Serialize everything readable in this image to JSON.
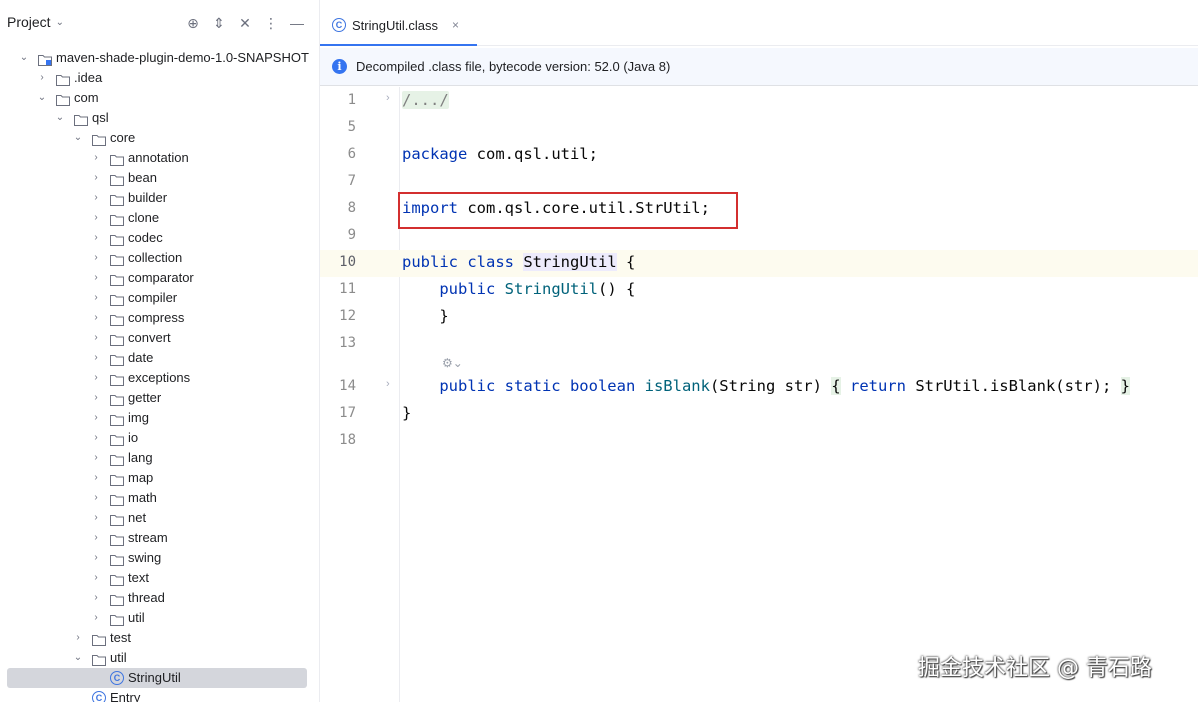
{
  "project_panel": {
    "title": "Project",
    "chevron": "⌄",
    "actions": [
      {
        "name": "locate-icon",
        "glyph": "⊕"
      },
      {
        "name": "expand-all-icon",
        "glyph": "⇕"
      },
      {
        "name": "collapse-all-icon",
        "glyph": "✕"
      },
      {
        "name": "options-icon",
        "glyph": "⋮"
      },
      {
        "name": "hide-icon",
        "glyph": "—"
      }
    ],
    "tree": [
      {
        "label": "maven-shade-plugin-demo-1.0-SNAPSHOT",
        "depth": 0,
        "expanded": true,
        "icon": "module"
      },
      {
        "label": ".idea",
        "depth": 1,
        "expanded": false,
        "icon": "folder"
      },
      {
        "label": "com",
        "depth": 1,
        "expanded": true,
        "icon": "folder"
      },
      {
        "label": "qsl",
        "depth": 2,
        "expanded": true,
        "icon": "folder"
      },
      {
        "label": "core",
        "depth": 3,
        "expanded": true,
        "icon": "folder"
      },
      {
        "label": "annotation",
        "depth": 4,
        "expanded": false,
        "icon": "folder"
      },
      {
        "label": "bean",
        "depth": 4,
        "expanded": false,
        "icon": "folder"
      },
      {
        "label": "builder",
        "depth": 4,
        "expanded": false,
        "icon": "folder"
      },
      {
        "label": "clone",
        "depth": 4,
        "expanded": false,
        "icon": "folder"
      },
      {
        "label": "codec",
        "depth": 4,
        "expanded": false,
        "icon": "folder"
      },
      {
        "label": "collection",
        "depth": 4,
        "expanded": false,
        "icon": "folder"
      },
      {
        "label": "comparator",
        "depth": 4,
        "expanded": false,
        "icon": "folder"
      },
      {
        "label": "compiler",
        "depth": 4,
        "expanded": false,
        "icon": "folder"
      },
      {
        "label": "compress",
        "depth": 4,
        "expanded": false,
        "icon": "folder"
      },
      {
        "label": "convert",
        "depth": 4,
        "expanded": false,
        "icon": "folder"
      },
      {
        "label": "date",
        "depth": 4,
        "expanded": false,
        "icon": "folder"
      },
      {
        "label": "exceptions",
        "depth": 4,
        "expanded": false,
        "icon": "folder"
      },
      {
        "label": "getter",
        "depth": 4,
        "expanded": false,
        "icon": "folder"
      },
      {
        "label": "img",
        "depth": 4,
        "expanded": false,
        "icon": "folder"
      },
      {
        "label": "io",
        "depth": 4,
        "expanded": false,
        "icon": "folder"
      },
      {
        "label": "lang",
        "depth": 4,
        "expanded": false,
        "icon": "folder"
      },
      {
        "label": "map",
        "depth": 4,
        "expanded": false,
        "icon": "folder"
      },
      {
        "label": "math",
        "depth": 4,
        "expanded": false,
        "icon": "folder"
      },
      {
        "label": "net",
        "depth": 4,
        "expanded": false,
        "icon": "folder"
      },
      {
        "label": "stream",
        "depth": 4,
        "expanded": false,
        "icon": "folder"
      },
      {
        "label": "swing",
        "depth": 4,
        "expanded": false,
        "icon": "folder"
      },
      {
        "label": "text",
        "depth": 4,
        "expanded": false,
        "icon": "folder"
      },
      {
        "label": "thread",
        "depth": 4,
        "expanded": false,
        "icon": "folder"
      },
      {
        "label": "util",
        "depth": 4,
        "expanded": false,
        "icon": "folder"
      },
      {
        "label": "test",
        "depth": 3,
        "expanded": false,
        "icon": "folder"
      },
      {
        "label": "util",
        "depth": 3,
        "expanded": true,
        "icon": "folder"
      },
      {
        "label": "StringUtil",
        "depth": 4,
        "leaf": true,
        "icon": "class",
        "selected": true
      },
      {
        "label": "Entry",
        "depth": 3,
        "leaf": true,
        "icon": "class"
      }
    ]
  },
  "editor": {
    "tab": {
      "icon_letter": "C",
      "label": "StringUtil.class",
      "close": "×"
    },
    "banner": {
      "icon": "i",
      "text": "Decompiled .class file, bytecode version: 52.0 (Java 8)"
    },
    "lines": [
      {
        "no": "1",
        "fold": "›"
      },
      {
        "no": "5"
      },
      {
        "no": "6"
      },
      {
        "no": "7"
      },
      {
        "no": "8"
      },
      {
        "no": "9"
      },
      {
        "no": "10",
        "current": true
      },
      {
        "no": "11"
      },
      {
        "no": "12"
      },
      {
        "no": "13"
      },
      {
        "no": "14",
        "fold": "›"
      },
      {
        "no": "17"
      },
      {
        "no": "18"
      }
    ],
    "code": {
      "l1": "/.../",
      "l6_kw": "package",
      "l6_rest": " com.qsl.util;",
      "l8_kw": "import",
      "l8_rest": " com.qsl.core.util.StrUtil;",
      "l10_kw": "public class",
      "l10_cls": "StringUtil",
      "l10_rest": " {",
      "l11_kw": "public",
      "l11_fn": "StringUtil",
      "l11_rest": "() {",
      "l12": "}",
      "l14_kw": "public static boolean",
      "l14_fn": "isBlank",
      "l14_params": "(String str)",
      "l14_ob": "{",
      "l14_kw2": "return",
      "l14_body": " StrUtil.isBlank(str);",
      "l14_cb": "}",
      "l17": "}"
    },
    "ai_hint": "⚙⌄"
  },
  "watermark": "掘金技术社区 @ 青石路"
}
